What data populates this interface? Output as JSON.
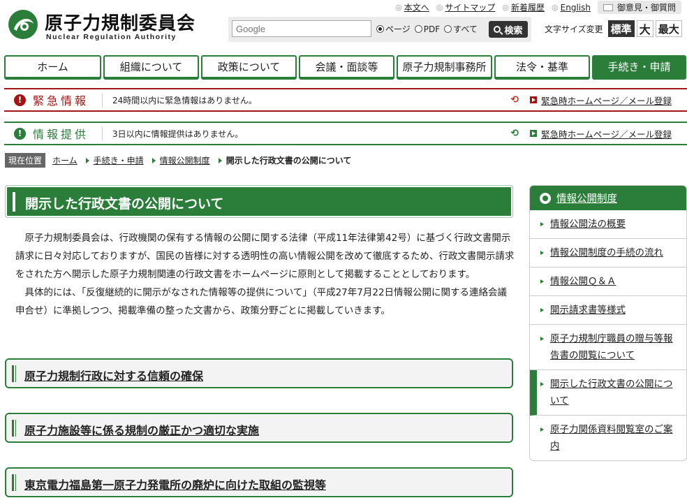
{
  "header": {
    "logo_title": "原子力規制委員会",
    "logo_sub": "Nuclear Regulation Authority",
    "toplinks": [
      "本文へ",
      "サイトマップ",
      "新着履歴",
      "English"
    ],
    "opinion": "御意見・御質問",
    "search": {
      "placeholder": "Google",
      "options": [
        "ページ",
        "PDF",
        "すべて"
      ],
      "selected": "ページ",
      "button": "検索"
    },
    "fontsize": {
      "label": "文字サイズ変更",
      "standard": "標準",
      "large": "大",
      "xlarge": "最大"
    }
  },
  "nav": {
    "items": [
      "ホーム",
      "組織について",
      "政策について",
      "会議・面談等",
      "原子力規制事務所",
      "法令・基準",
      "手続き・申請"
    ],
    "active": "手続き・申請"
  },
  "alerts": {
    "emergency": {
      "title": "緊急情報",
      "message": "24時間以内に緊急情報はありません。",
      "link": "緊急時ホームページ／メール登録"
    },
    "info": {
      "title": "情報提供",
      "message": "3日以内に情報提供はありません。",
      "link": "緊急時ホームページ／メール登録"
    }
  },
  "breadcrumb": {
    "label": "現在位置",
    "items": [
      "ホーム",
      "手続き・申請",
      "情報公開制度",
      "開示した行政文書の公開について"
    ]
  },
  "main": {
    "title": "開示した行政文書の公開について",
    "para1": "原子力規制委員会は、行政機関の保有する情報の公開に関する法律（平成11年法律第42号）に基づく行政文書開示請求に日々対応しておりますが、国民の皆様に対する透明性の高い情報公開を改めて徹底するため、行政文書開示請求をされた方へ開示した原子力規制関連の行政文書をホームページに原則として掲載することとしております。",
    "para2": "具体的には、「反復継続的に開示がなされた情報等の提供について」（平成27年7月22日情報公開に関する連絡会議申合せ）に準拠しつつ、掲載準備の整った文書から、政策分野ごとに掲載していきます。",
    "sections": [
      "原子力規制行政に対する信頼の確保",
      "原子力施設等に係る規制の厳正かつ適切な実施",
      "東京電力福島第一原子力発電所の廃炉に向けた取組の監視等"
    ]
  },
  "sidebar": {
    "title": "情報公開制度",
    "items": [
      "情報公開法の概要",
      "情報公開制度の手続の流れ",
      "情報公開Ｑ＆Ａ",
      "開示請求書等様式",
      "原子力規制庁職員の贈与等報告書の閲覧について",
      "開示した行政文書の公開について",
      "原子力関係資料閲覧室のご案内"
    ],
    "current": "開示した行政文書の公開について"
  },
  "colors": {
    "green": "#2b7d3a",
    "red": "#a31515"
  }
}
